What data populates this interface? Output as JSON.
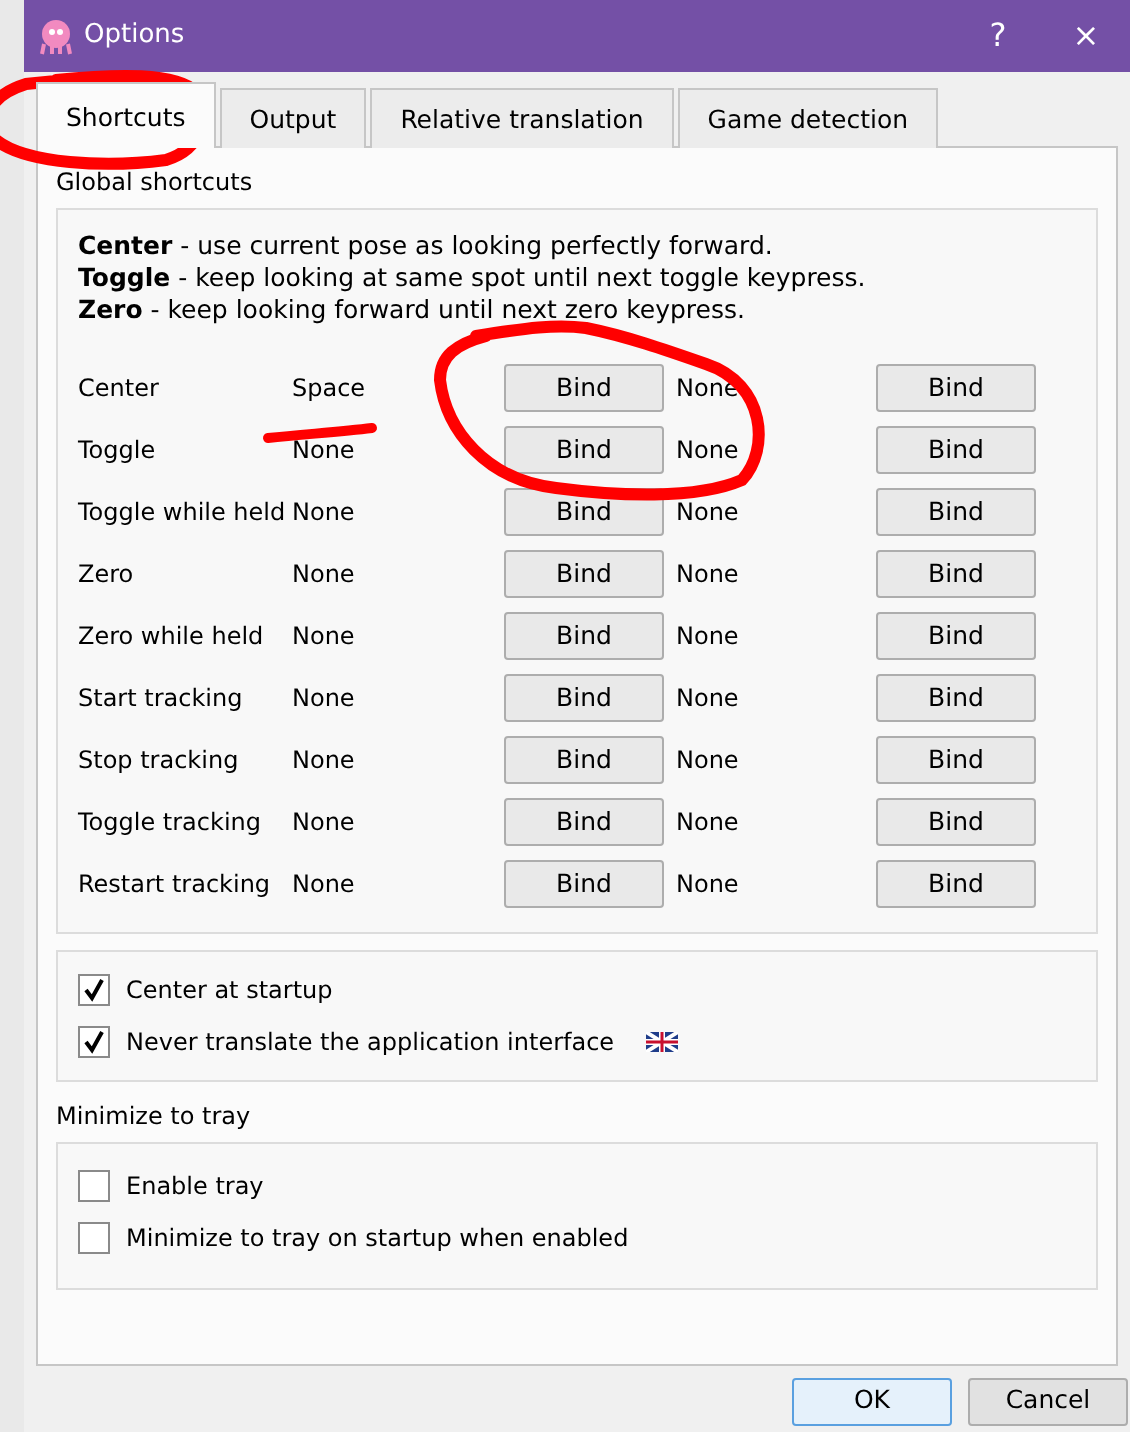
{
  "window": {
    "title": "Options",
    "help": "?",
    "close": "×"
  },
  "tabs": [
    {
      "label": "Shortcuts",
      "selected": true
    },
    {
      "label": "Output",
      "selected": false
    },
    {
      "label": "Relative translation",
      "selected": false
    },
    {
      "label": "Game detection",
      "selected": false
    }
  ],
  "global_shortcuts": {
    "title": "Global shortcuts",
    "help_lines": [
      "**Center** - use current pose as looking perfectly forward.",
      "**Toggle** - keep looking at same spot until next toggle keypress.",
      "**Zero** - keep looking forward until next zero keypress."
    ],
    "rows": [
      {
        "action": "Center",
        "key": "Space",
        "bind": "Bind",
        "alt_key": "None",
        "alt_bind": "Bind"
      },
      {
        "action": "Toggle",
        "key": "None",
        "bind": "Bind",
        "alt_key": "None",
        "alt_bind": "Bind"
      },
      {
        "action": "Toggle while held",
        "key": "None",
        "bind": "Bind",
        "alt_key": "None",
        "alt_bind": "Bind"
      },
      {
        "action": "Zero",
        "key": "None",
        "bind": "Bind",
        "alt_key": "None",
        "alt_bind": "Bind"
      },
      {
        "action": "Zero while held",
        "key": "None",
        "bind": "Bind",
        "alt_key": "None",
        "alt_bind": "Bind"
      },
      {
        "action": "Start tracking",
        "key": "None",
        "bind": "Bind",
        "alt_key": "None",
        "alt_bind": "Bind"
      },
      {
        "action": "Stop tracking",
        "key": "None",
        "bind": "Bind",
        "alt_key": "None",
        "alt_bind": "Bind"
      },
      {
        "action": "Toggle tracking",
        "key": "None",
        "bind": "Bind",
        "alt_key": "None",
        "alt_bind": "Bind"
      },
      {
        "action": "Restart tracking",
        "key": "None",
        "bind": "Bind",
        "alt_key": "None",
        "alt_bind": "Bind"
      }
    ]
  },
  "options": [
    {
      "label": "Center at startup",
      "checked": true,
      "flag": false
    },
    {
      "label": "Never translate the application interface",
      "checked": true,
      "flag": true
    }
  ],
  "tray": {
    "title": "Minimize to tray",
    "options": [
      {
        "label": "Enable tray",
        "checked": false
      },
      {
        "label": "Minimize to tray on startup when enabled",
        "checked": false
      }
    ]
  },
  "buttons": [
    {
      "label": "OK",
      "default": true
    },
    {
      "label": "Cancel",
      "default": false
    }
  ]
}
